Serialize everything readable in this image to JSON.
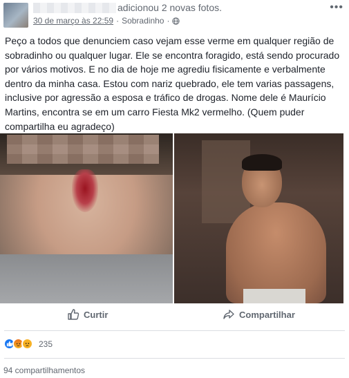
{
  "header": {
    "action_text": "adicionou 2 novas fotos.",
    "timestamp": "30 de março às 22:59",
    "separator": "·",
    "location": "Sobradinho",
    "more_label": "•••"
  },
  "post": {
    "text": "Peço a todos que denunciem caso vejam esse verme em qualquer região de sobradinho ou qualquer lugar. Ele se encontra foragido, está sendo procurado por vários motivos. E no dia de hoje me agrediu fisicamente e verbalmente dentro da minha casa. Estou com nariz quebrado, ele tem varias passagens, inclusive por agressão a esposa e tráfico de drogas. Nome dele é Maurício Martins, encontra se em um carro Fiesta Mk2 vermelho. (Quem puder compartilha eu agradeço)"
  },
  "actions": {
    "like_label": "Curtir",
    "share_label": "Compartilhar"
  },
  "stats": {
    "reactions_count": "235",
    "shares_label": "94 compartilhamentos"
  },
  "colors": {
    "accent": "#1877f2",
    "secondary_text": "#616770"
  }
}
